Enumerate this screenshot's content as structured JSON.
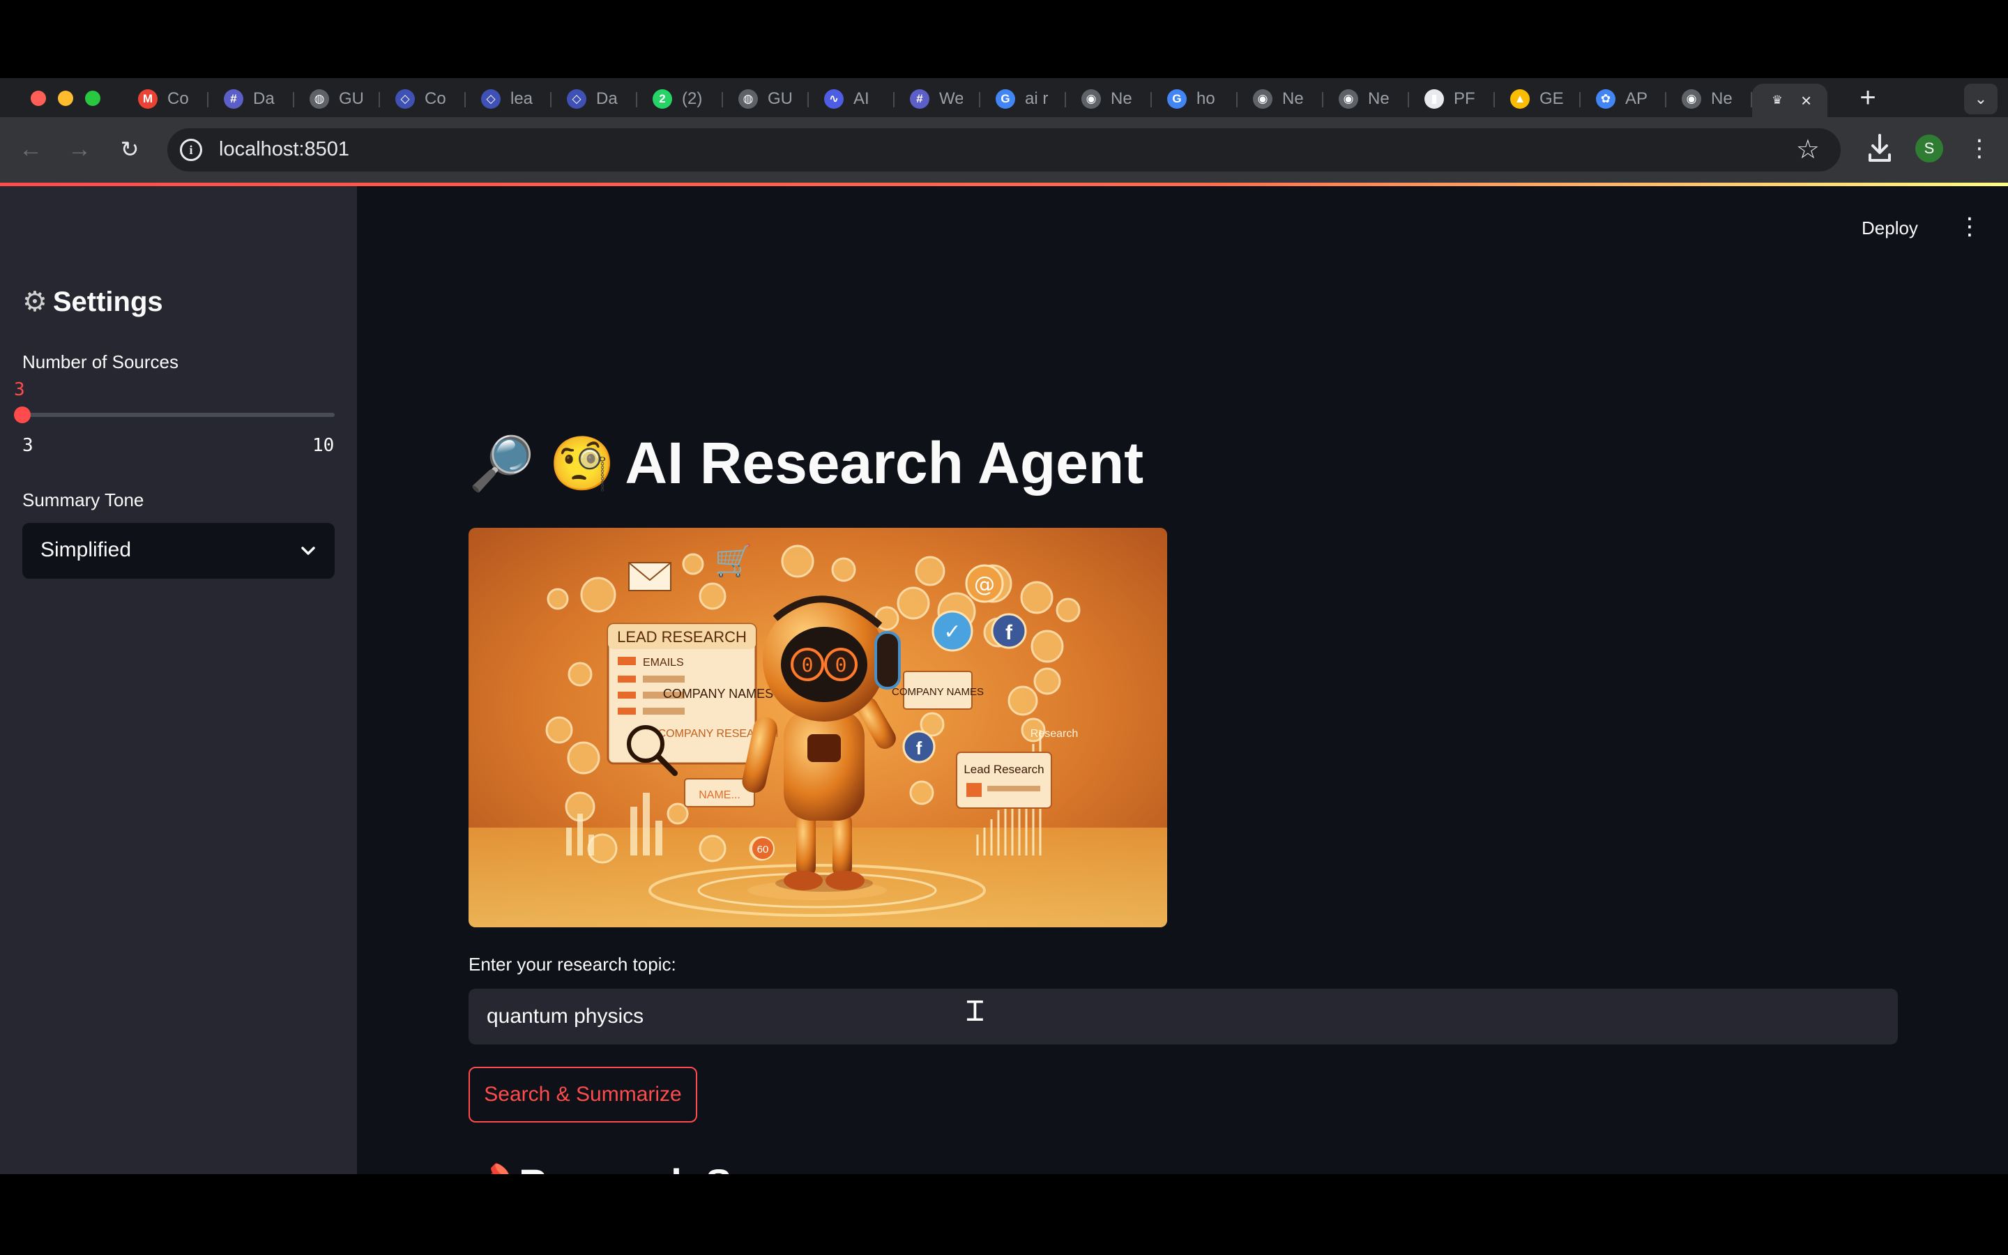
{
  "browser": {
    "tabs": [
      {
        "favicon": "gmail-icon",
        "title": "Co",
        "color": "#ea4335",
        "glyph": "M"
      },
      {
        "favicon": "app-grid-icon",
        "title": "Da",
        "color": "#5b5fc7",
        "glyph": "#"
      },
      {
        "favicon": "globe-icon",
        "title": "GU",
        "color": "#5f6368",
        "glyph": "◍"
      },
      {
        "favicon": "code-brackets-icon",
        "title": "Co",
        "color": "#3f51b5",
        "glyph": "◇"
      },
      {
        "favicon": "code-brackets-icon",
        "title": "lea",
        "color": "#3f51b5",
        "glyph": "◇"
      },
      {
        "favicon": "code-brackets-icon",
        "title": "Da",
        "color": "#3f51b5",
        "glyph": "◇"
      },
      {
        "favicon": "whatsapp-icon",
        "title": "(2)",
        "color": "#25d366",
        "glyph": "2"
      },
      {
        "favicon": "globe-icon",
        "title": "GU",
        "color": "#5f6368",
        "glyph": "◍"
      },
      {
        "favicon": "ai-logo-icon",
        "title": "AI",
        "color": "#4e5ee4",
        "glyph": "∿"
      },
      {
        "favicon": "app-grid-icon",
        "title": "We",
        "color": "#5b5fc7",
        "glyph": "#"
      },
      {
        "favicon": "google-icon",
        "title": "ai r",
        "color": "#4285f4",
        "glyph": "G"
      },
      {
        "favicon": "chrome-icon",
        "title": "Ne",
        "color": "#5f6368",
        "glyph": "◉"
      },
      {
        "favicon": "google-icon",
        "title": "ho",
        "color": "#4285f4",
        "glyph": "G"
      },
      {
        "favicon": "chrome-icon",
        "title": "Ne",
        "color": "#5f6368",
        "glyph": "◉"
      },
      {
        "favicon": "chrome-icon",
        "title": "Ne",
        "color": "#5f6368",
        "glyph": "◉"
      },
      {
        "favicon": "document-icon",
        "title": "PF",
        "color": "#e8eaed",
        "glyph": "▮"
      },
      {
        "favicon": "google-drive-icon",
        "title": "GE",
        "color": "#fbbc04",
        "glyph": "▲"
      },
      {
        "favicon": "openai-icon",
        "title": "AP",
        "color": "#4285f4",
        "glyph": "✿"
      },
      {
        "favicon": "chrome-icon",
        "title": "Ne",
        "color": "#5f6368",
        "glyph": "◉"
      }
    ],
    "active_tab": {
      "favicon": "streamlit-crown-icon",
      "title": ""
    },
    "url": "localhost:8501",
    "profile_initial": "S"
  },
  "sidebar": {
    "title": "Settings",
    "sources_label": "Number of Sources",
    "sources_value": "3",
    "sources_min": "3",
    "sources_max": "10",
    "sources_fraction": 0.0,
    "tone_label": "Summary Tone",
    "tone_value": "Simplified"
  },
  "header": {
    "deploy_label": "Deploy"
  },
  "main": {
    "title_emoji": "🔎 🧐",
    "title": "AI Research Agent",
    "hero_labels": {
      "lead_research": "LEAD RESEARCH",
      "emails": "EMAILS",
      "company_names": "COMPANY NAMES",
      "company_research": "COMPANY RESEARCH",
      "name": "NAME...",
      "company_names_2": "COMPANY NAMES",
      "lead_research_2": "Lead Research",
      "research": "Research",
      "number": "60"
    },
    "topic_label": "Enter your research topic:",
    "topic_value": "quantum physics",
    "search_button": "Search & Summarize",
    "summary_emoji": "📌",
    "summary_heading": "Research Summary"
  },
  "colors": {
    "accent": "#ff4b4b",
    "background": "#0e1117",
    "sidebar": "#262730"
  }
}
